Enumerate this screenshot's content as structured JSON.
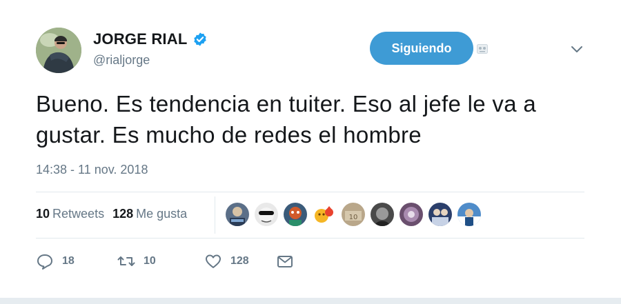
{
  "user": {
    "display_name": "JORGE RIAL",
    "handle": "@rialjorge",
    "verified_icon": "verified-badge-icon",
    "verified_color": "#1da1f2"
  },
  "follow_button": {
    "label": "Siguiendo",
    "color": "#3e9bd5"
  },
  "tweet": {
    "text": "Bueno. Es tendencia en tuiter. Eso al jefe le va a gustar. Es mucho de redes el hombre",
    "timestamp": "14:38 - 11 nov. 2018"
  },
  "stats": {
    "retweets_count": "10",
    "retweets_label": "Retweets",
    "likes_count": "128",
    "likes_label": "Me gusta"
  },
  "likers": [
    {
      "icon": "liker-avatar-1"
    },
    {
      "icon": "liker-avatar-2"
    },
    {
      "icon": "liker-avatar-3"
    },
    {
      "icon": "liker-avatar-4"
    },
    {
      "icon": "liker-avatar-5"
    },
    {
      "icon": "liker-avatar-6"
    },
    {
      "icon": "liker-avatar-7"
    },
    {
      "icon": "liker-avatar-8"
    },
    {
      "icon": "liker-avatar-9"
    }
  ],
  "actions": {
    "reply": {
      "icon": "reply-icon",
      "count": "18"
    },
    "retweet": {
      "icon": "retweet-icon",
      "count": "10"
    },
    "like": {
      "icon": "heart-icon",
      "count": "128"
    },
    "message": {
      "icon": "envelope-icon"
    }
  },
  "colors": {
    "text": "#14171a",
    "muted": "#657786",
    "divider": "#e1e8ed"
  }
}
